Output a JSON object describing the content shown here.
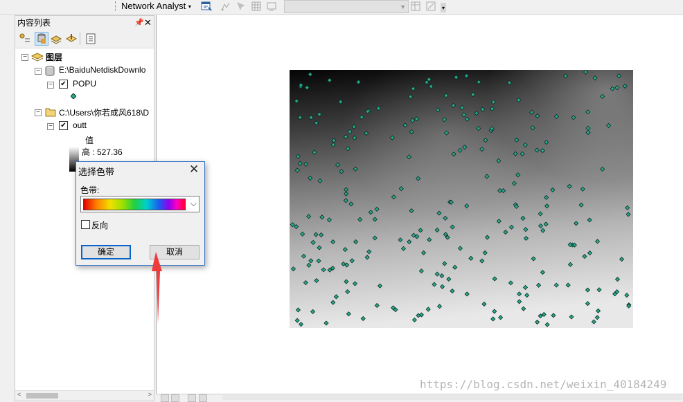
{
  "toolbar": {
    "network_analyst_label": "Network Analyst",
    "dropdown_arrow": "▾"
  },
  "toc": {
    "title": "内容列表",
    "pin_glyph": "ᵖ",
    "close_glyph": "✕",
    "root_label": "图层",
    "layers": [
      {
        "label": "E:\\BaiduNetdiskDownlo",
        "child_label": "POPU",
        "checked": true
      },
      {
        "label": "C:\\Users\\你若成风618\\D",
        "child_label": "outt",
        "checked": true
      }
    ],
    "legend_heading": "值",
    "legend_high": "高 : 527.36"
  },
  "dialog": {
    "title": "选择色带",
    "close_glyph": "✕",
    "ramp_label": "色带:",
    "reverse_label": "反向",
    "ok_label": "确定",
    "cancel_label": "取消"
  },
  "watermark": "https://blog.csdn.net/weixin_40184249",
  "colors": {
    "point_fill": "#2aa88c",
    "dialog_border": "#3c78c8",
    "annotation_arrow": "#ee3b3b"
  }
}
